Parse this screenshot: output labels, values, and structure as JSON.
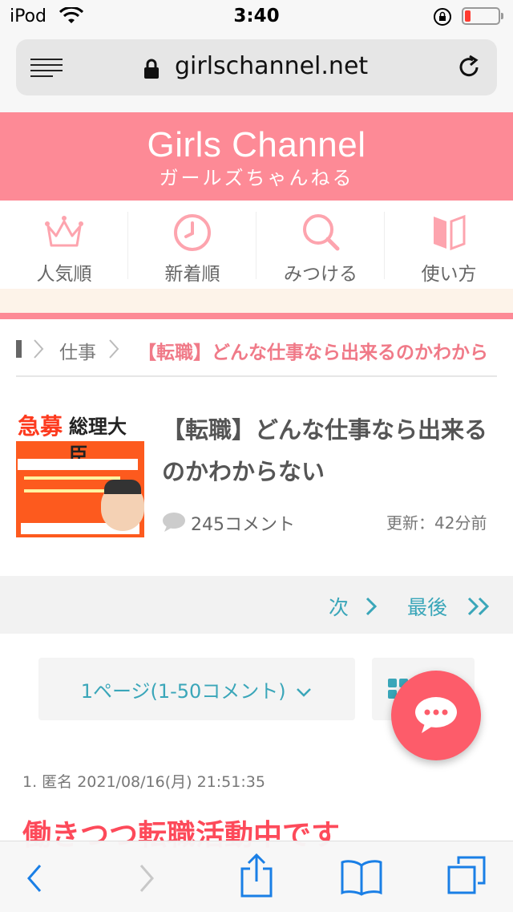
{
  "status_bar": {
    "carrier": "iPod",
    "time": "3:40"
  },
  "browser": {
    "domain": "girlschannel.net"
  },
  "header": {
    "logo": "Girls Channel",
    "logo_sub": "ガールズちゃんねる"
  },
  "nav": {
    "items": [
      {
        "label": "人気順",
        "icon": "crown-icon"
      },
      {
        "label": "新着順",
        "icon": "clock-icon"
      },
      {
        "label": "みつける",
        "icon": "search-icon"
      },
      {
        "label": "使い方",
        "icon": "book-icon"
      }
    ]
  },
  "breadcrumb": {
    "category": "仕事",
    "current": "【転職】どんな仕事なら出来るのかわから"
  },
  "topic": {
    "title": "【転職】どんな仕事なら出来るのかわからない",
    "comment_count": "245コメント",
    "updated": "更新：42分前",
    "thumbnail_text": [
      "急募",
      "総理大臣"
    ]
  },
  "pager": {
    "next": "次",
    "last": "最後"
  },
  "page_select": {
    "label": "1ページ(1-50コメント)"
  },
  "comment": {
    "meta": "1. 匿名 2021/08/16(月) 21:51:35",
    "body": "働きつつ転職活動中です"
  },
  "colors": {
    "brand_pink": "#fd8a96",
    "accent_teal": "#3aa6b9",
    "fab_red": "#fd5c6a"
  }
}
